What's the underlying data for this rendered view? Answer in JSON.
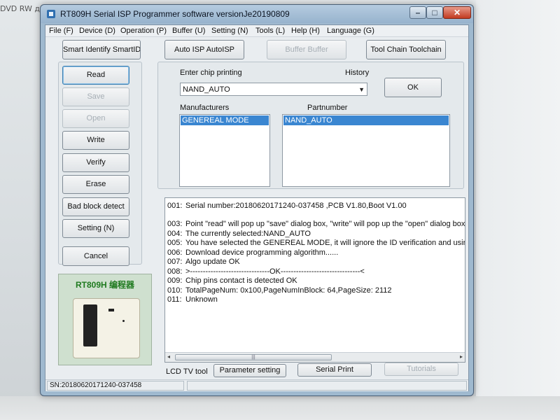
{
  "background_text": "DVD RW дис",
  "window": {
    "title": "RT809H Serial ISP Programmer software versionJe20190809",
    "minimize_glyph": "–",
    "maximize_glyph": "□",
    "close_glyph": "✕"
  },
  "menu": [
    "File (F)",
    "Device (D)",
    "Operation (P)",
    "Buffer (U)",
    "Setting (N)",
    "Tools (L)",
    "Help (H)",
    "Language (G)"
  ],
  "toolbar": {
    "smart_id": "Smart Identify SmartID",
    "auto_isp": "Auto ISP AutoISP",
    "buffer": "Buffer Buffer",
    "tool_chain": "Tool Chain Toolchain"
  },
  "actions": {
    "read": "Read",
    "save": "Save",
    "open": "Open",
    "write": "Write",
    "verify": "Verify",
    "erase": "Erase",
    "bad_block": "Bad block detect",
    "setting": "Setting (N)",
    "cancel": "Cancel"
  },
  "chip": {
    "label": "Enter chip printing",
    "history_label": "History",
    "value": "NAND_AUTO",
    "ok": "OK"
  },
  "manufacturers": {
    "label": "Manufacturers",
    "selected": "GENEREAL MODE"
  },
  "partnumber": {
    "label": "Partnumber",
    "selected": "NAND_AUTO"
  },
  "log": [
    {
      "num": "001:",
      "text": "Serial number:20180620171240-037458  ,PCB V1.80,Boot V1.00"
    },
    {
      "num": "003:",
      "text": "Point \"read\" will pop up \"save\" dialog box, \"write\" will pop up the \"open\" dialog box"
    },
    {
      "num": "004:",
      "text": "The currently selected:NAND_AUTO"
    },
    {
      "num": "005:",
      "text": "You have selected the GENEREAL MODE, it will ignore the ID verification and usir"
    },
    {
      "num": "006:",
      "text": "Download device programming algorithm......"
    },
    {
      "num": "007:",
      "text": "Algo update OK"
    },
    {
      "num": "008:",
      "text": ">-------------------------------OK-------------------------------<"
    },
    {
      "num": "009:",
      "text": "Chip pins contact is detected OK"
    },
    {
      "num": "010:",
      "text": "TotalPageNum: 0x100,PageNumInBlock: 64,PageSize: 2112"
    },
    {
      "num": "011:",
      "text": "Unknown"
    }
  ],
  "bottom": {
    "lcd_tv_tool": "LCD TV tool",
    "parameter_setting": "Parameter setting",
    "serial_print": "Serial Print",
    "tutorials": "Tutorials"
  },
  "device_image": {
    "brand": "RT809H 编程器"
  },
  "status": {
    "serial": "SN:20180620171240-037458"
  }
}
